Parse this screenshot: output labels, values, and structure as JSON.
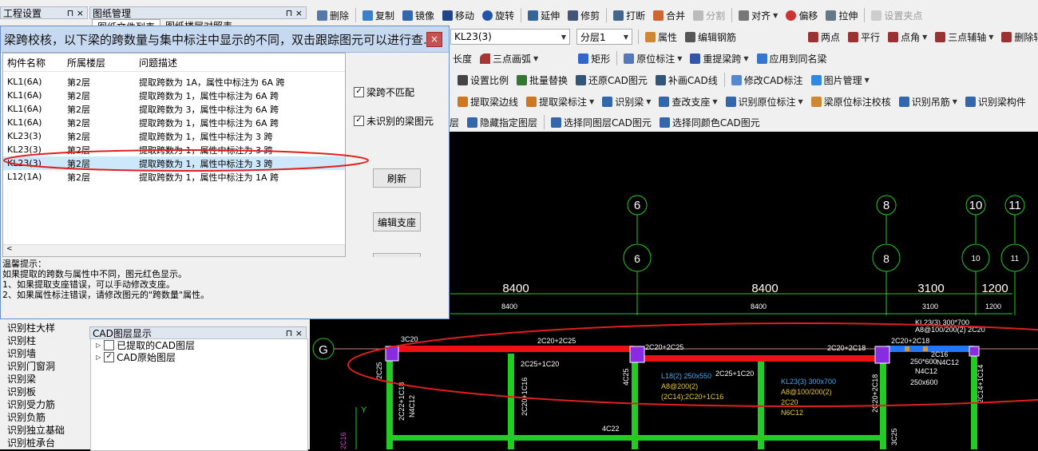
{
  "left_panel": {
    "top_tab_fragment": "工程设置",
    "drawing_mgr_title": "图纸管理",
    "tabs": [
      "图纸文件列表",
      "图纸楼层对照表"
    ],
    "menu_items": [
      "识别柱大样",
      "识别柱",
      "识别墙",
      "识别门窗洞",
      "识别梁",
      "识别板",
      "识别受力筋",
      "识别负筋",
      "识别独立基础",
      "识别桩承台"
    ],
    "cad_layer_panel_title": "CAD图层显示",
    "cad_layers": [
      {
        "label": "已提取的CAD图层",
        "checked": false
      },
      {
        "label": "CAD原始图层",
        "checked": true
      }
    ]
  },
  "dialog": {
    "title": "梁跨校核，以下梁的跨数量与集中标注中显示的不同，双击跟踪图元可以进行查...",
    "close": "×",
    "columns": [
      "构件名称",
      "所属楼层",
      "问题描述"
    ],
    "rows": [
      {
        "name": "KL1(6A)",
        "floor": "第2层",
        "desc": "提取跨数为 1A，属性中标注为 6A 跨"
      },
      {
        "name": "KL1(6A)",
        "floor": "第2层",
        "desc": "提取跨数为 1，属性中标注为 6A 跨"
      },
      {
        "name": "KL1(6A)",
        "floor": "第2层",
        "desc": "提取跨数为 3，属性中标注为 6A 跨"
      },
      {
        "name": "KL1(6A)",
        "floor": "第2层",
        "desc": "提取跨数为 1，属性中标注为 6A 跨"
      },
      {
        "name": "KL23(3)",
        "floor": "第2层",
        "desc": "提取跨数为 1，属性中标注为 3 跨"
      },
      {
        "name": "KL23(3)",
        "floor": "第2层",
        "desc": "提取跨数为 1，属性中标注为 3 跨"
      },
      {
        "name": "KL23(3)",
        "floor": "第2层",
        "desc": "提取跨数为 1，属性中标注为 3 跨"
      },
      {
        "name": "L12(1A)",
        "floor": "第2层",
        "desc": "提取跨数为 1，属性中标注为 1A 跨"
      }
    ],
    "selected_row": 6,
    "filters": [
      {
        "label": "梁跨不匹配",
        "checked": true
      },
      {
        "label": "未识别的梁图元",
        "checked": true
      }
    ],
    "buttons": [
      "刷新",
      "编辑支座"
    ],
    "tips": [
      "温馨提示：",
      "如果提取的跨数与属性中不同，图元红色显示。",
      "1、如果提取支座错误，可以手动修改支座。",
      "2、如果属性标注错误，请修改图元的\"跨数量\"属性。"
    ]
  },
  "toolbar": {
    "row1": [
      "删除",
      "复制",
      "镜像",
      "移动",
      "旋转",
      "延伸",
      "修剪",
      "打断",
      "合并",
      "分割",
      "对齐",
      "偏移",
      "拉伸",
      "设置夹点"
    ],
    "row2_combo_beam": "KL23(3)",
    "row2_combo_layer": "分层1",
    "row2": [
      "属性",
      "编辑钢筋",
      "两点",
      "平行",
      "点角",
      "三点辅轴",
      "删除辅轴"
    ],
    "row3": [
      "长度",
      "三点画弧",
      "矩形",
      "原位标注",
      "重提梁跨",
      "应用到同名梁"
    ],
    "row4": [
      "设置比例",
      "批量替换",
      "还原CAD图元",
      "补画CAD线",
      "修改CAD标注",
      "图片管理"
    ],
    "row5": [
      "提取梁边线",
      "提取梁标注",
      "识别梁",
      "查改支座",
      "识别原位标注",
      "梁原位标注校核",
      "识别吊筋",
      "识别梁构件"
    ],
    "row6": [
      "层",
      "隐藏指定图层",
      "选择同图层CAD图元",
      "选择同颜色CAD图元"
    ]
  },
  "cad": {
    "axes": [
      "6",
      "8",
      "10",
      "11"
    ],
    "row_axis": "G",
    "dims_big": [
      "8400",
      "8400",
      "3100",
      "1200"
    ],
    "dims_small": [
      "8400",
      "8400",
      "3100",
      "1200"
    ],
    "annotations": {
      "kl23_top": "KL23(3) 300*700",
      "kl23_top2": "A8@100/200(2) 2C20",
      "beam_2c20_2c25": "2C20+2C25",
      "beam_2c20_2c25b": "2C20+2C25",
      "beam_3c20": "3C20",
      "beam_2c20_2c18": "2C20+2C18",
      "c2": "2C20+2C18",
      "c3": "2C25+1C20",
      "c4": "2C25+1C20",
      "c5": "4C25",
      "c6": "250*600",
      "c7": "N4C12",
      "c8": "250x600",
      "c9": "2C16",
      "c10": "N4C12",
      "l18": "L18(2) 250x550",
      "l18b": "A8@200(2)",
      "l18c": "(2C14);2C20+1C16",
      "kl23b": "KL23(3) 300x700",
      "kl23c": "A8@100/200(2)",
      "kl23d": "2C20",
      "kl23e": "N6C12",
      "v1": "2C25",
      "v2": "2C22+1C18",
      "v3": "N4C12",
      "v4": "2C20+1C16",
      "v5": "4C25",
      "v6": "2C20+2C18",
      "v7": "3C25",
      "v8": "2C14+1C14",
      "v9": "4C22",
      "v10": "2C16",
      "v11": "Y"
    }
  },
  "colors": {
    "highlight_oval": "#e02020",
    "beam_green": "#22cc22",
    "beam_red": "#ee1111",
    "beam_blue": "#2277ff",
    "column_purple": "#8a2be2",
    "axis_green": "#22cc22",
    "dialog_title_bg": "#c7d9f1"
  }
}
